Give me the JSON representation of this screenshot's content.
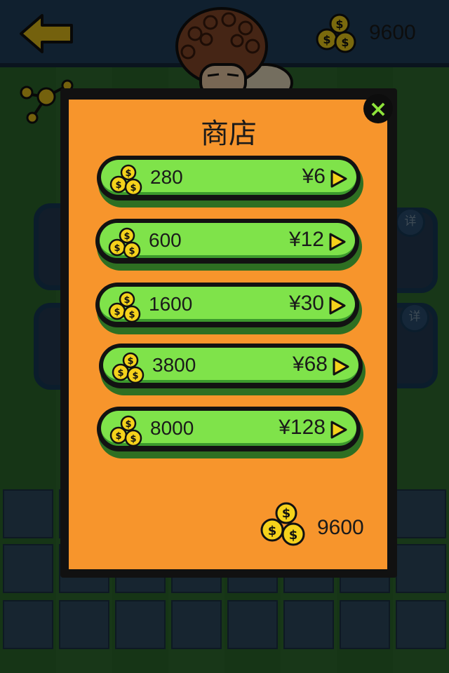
{
  "header": {
    "balance": "9600",
    "back_icon": "back-arrow-icon",
    "coins_icon": "coins-icon"
  },
  "background": {
    "detail_label_1": "详",
    "detail_label_2": "详"
  },
  "shop": {
    "title": "商店",
    "packs": [
      {
        "amount": "280",
        "price": "¥6"
      },
      {
        "amount": "600",
        "price": "¥12"
      },
      {
        "amount": "1600",
        "price": "¥30"
      },
      {
        "amount": "3800",
        "price": "¥68"
      },
      {
        "amount": "8000",
        "price": "¥128"
      }
    ],
    "balance": "9600",
    "close_label": "×"
  },
  "colors": {
    "modal_bg": "#f7952c",
    "pill_green": "#7fe34a",
    "coin_gold": "#f5d21b",
    "close_green": "#8ee33b"
  }
}
